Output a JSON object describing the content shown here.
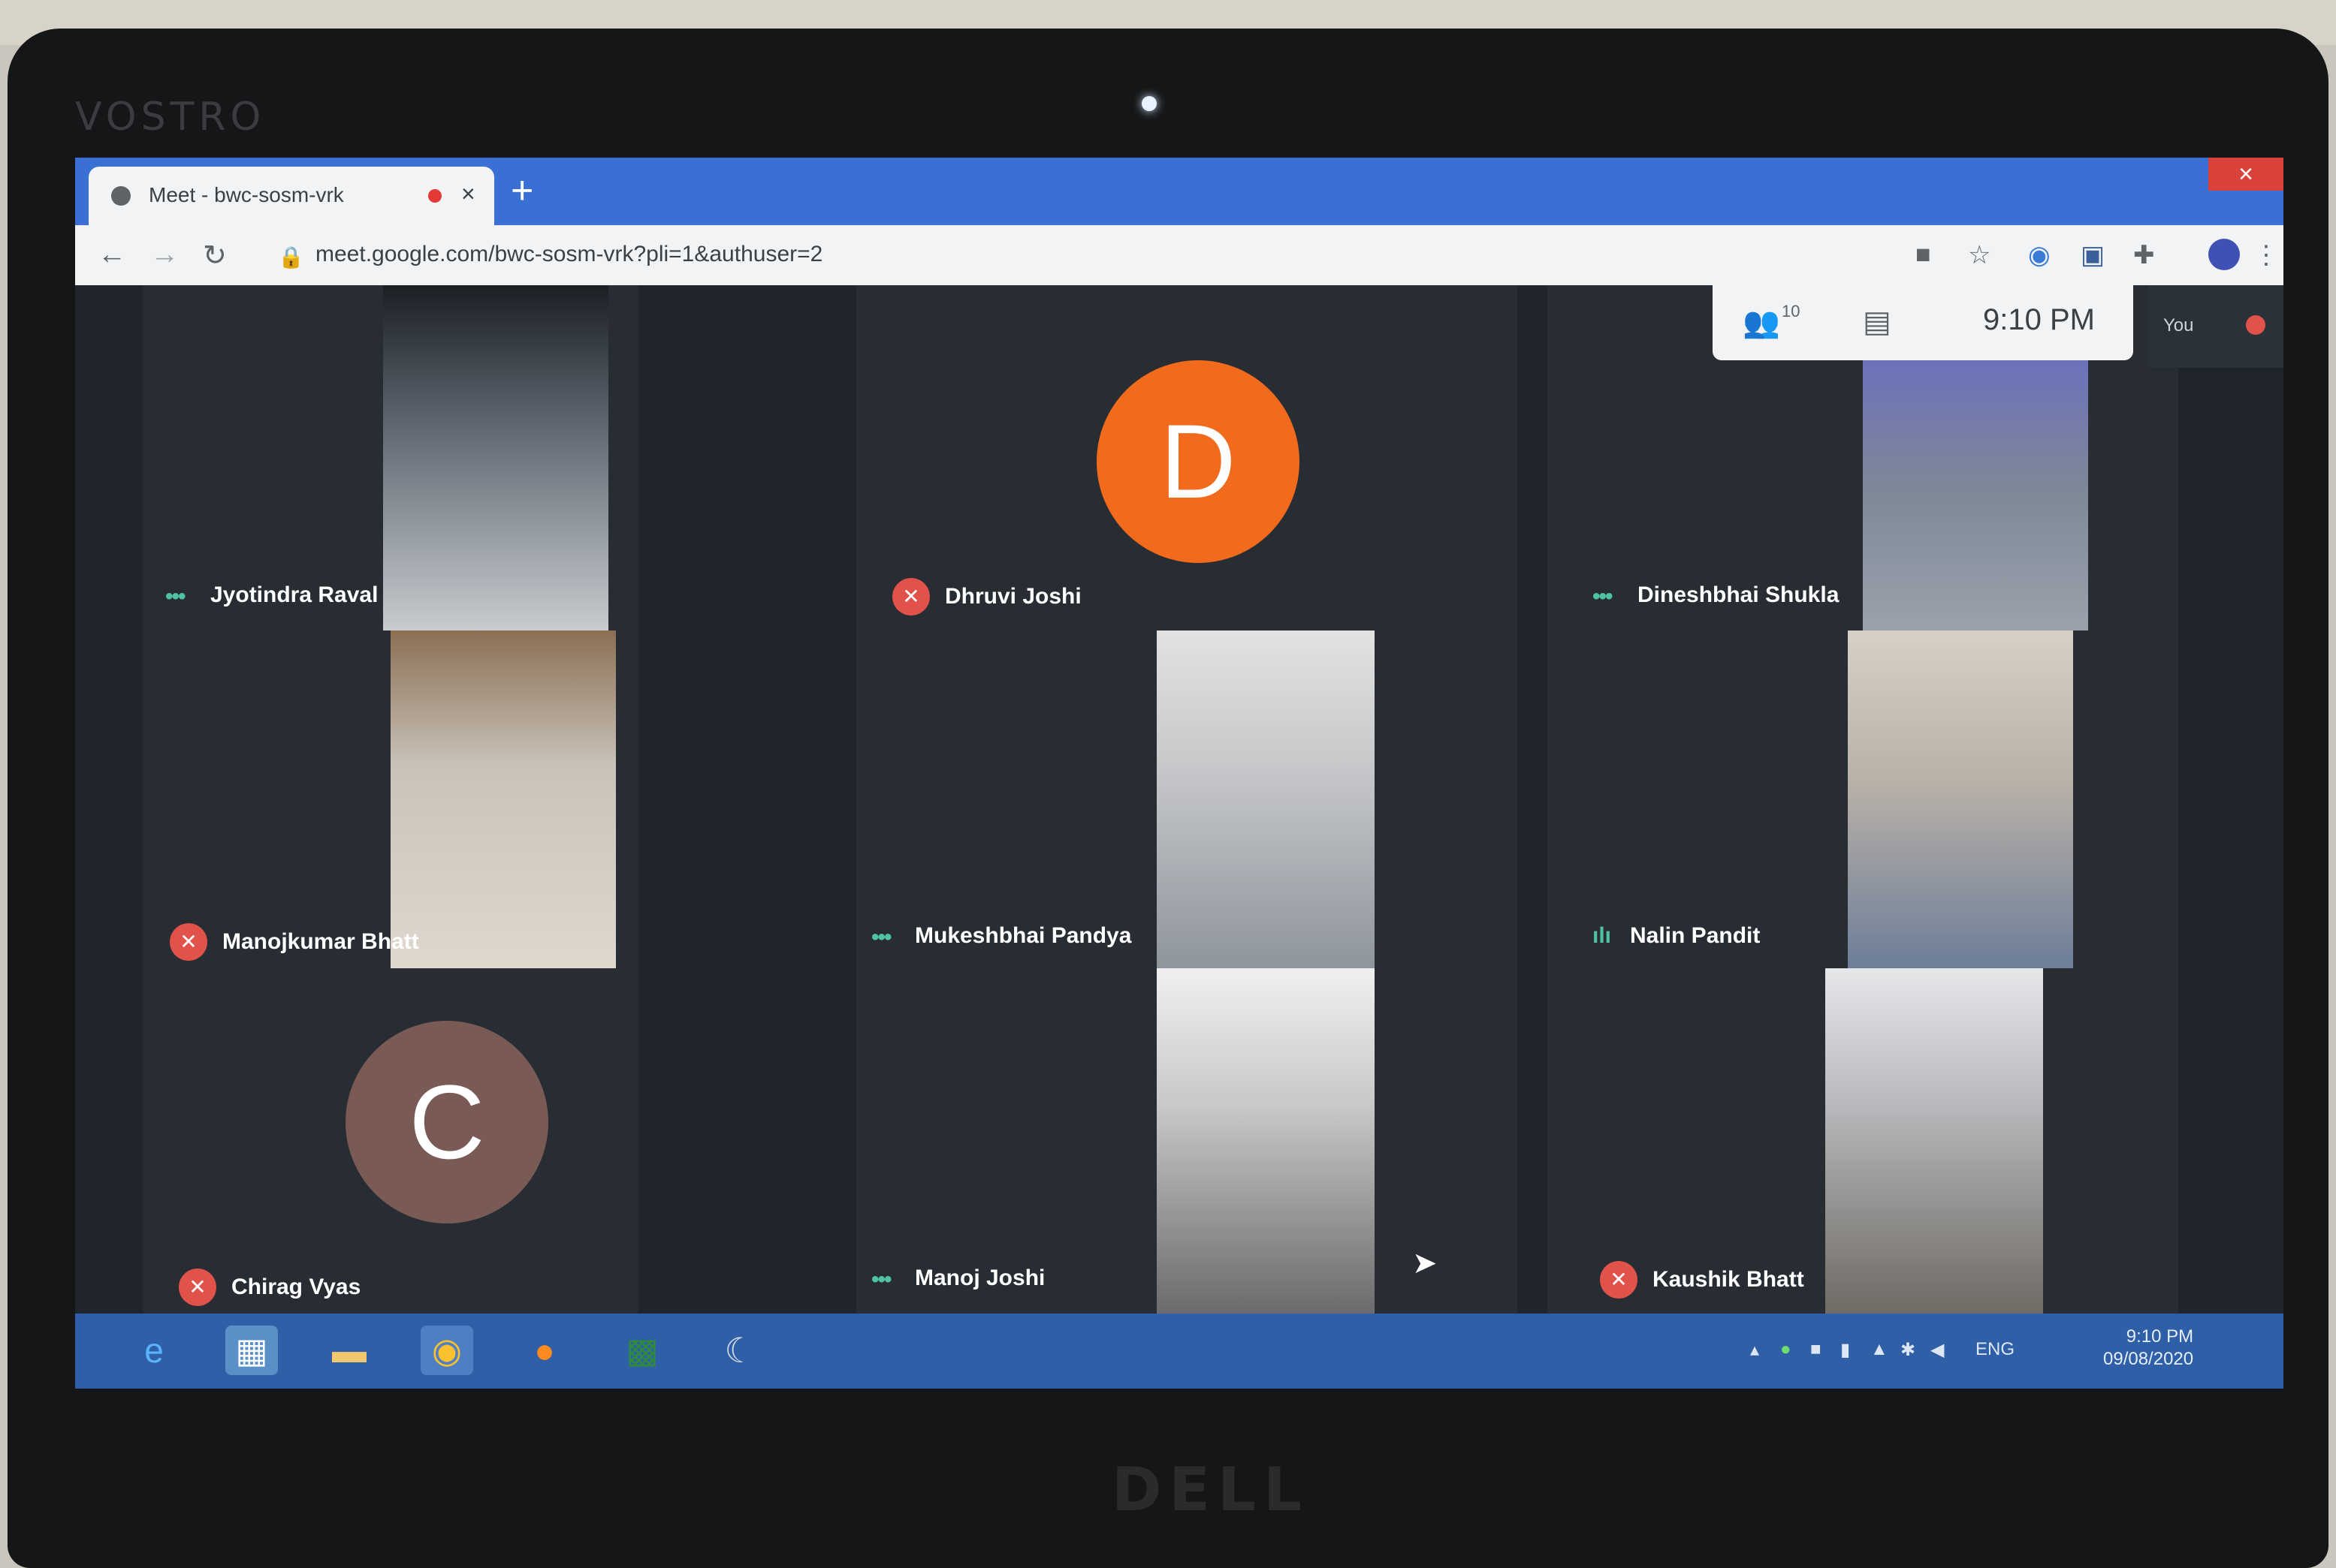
{
  "hardware": {
    "brand_top": "VOSTRO",
    "brand_bottom": "DELL"
  },
  "browser": {
    "tab_title": "Meet - bwc-sosm-vrk",
    "tab_close": "×",
    "new_tab": "+",
    "url": "meet.google.com/bwc-sosm-vrk?pli=1&authuser=2",
    "window_close": "×"
  },
  "meet": {
    "time": "9:10 PM",
    "participants_count": "10",
    "self_label": "You",
    "participants": [
      {
        "name": "Jyotindra Raval",
        "status": "speaking-dots"
      },
      {
        "name": "Dhruvi Joshi",
        "status": "muted",
        "avatar_letter": "D",
        "avatar_color": "#f26a1b"
      },
      {
        "name": "Dineshbhai Shukla",
        "status": "speaking-dots"
      },
      {
        "name": "Manojkumar Bhatt",
        "status": "muted"
      },
      {
        "name": "Mukeshbhai Pandya",
        "status": "speaking-dots"
      },
      {
        "name": "Nalin Pandit",
        "status": "speaking-bars"
      },
      {
        "name": "Chirag Vyas",
        "status": "muted",
        "avatar_letter": "C",
        "avatar_color": "#7a5a55"
      },
      {
        "name": "Manoj Joshi",
        "status": "speaking-dots"
      },
      {
        "name": "Kaushik Bhatt",
        "status": "muted"
      }
    ]
  },
  "taskbar": {
    "apps": [
      "internet-explorer",
      "photo-viewer",
      "file-explorer",
      "chrome",
      "firefox",
      "excel",
      "app"
    ],
    "language": "ENG",
    "clock_time": "9:10 PM",
    "clock_date": "09/08/2020"
  }
}
